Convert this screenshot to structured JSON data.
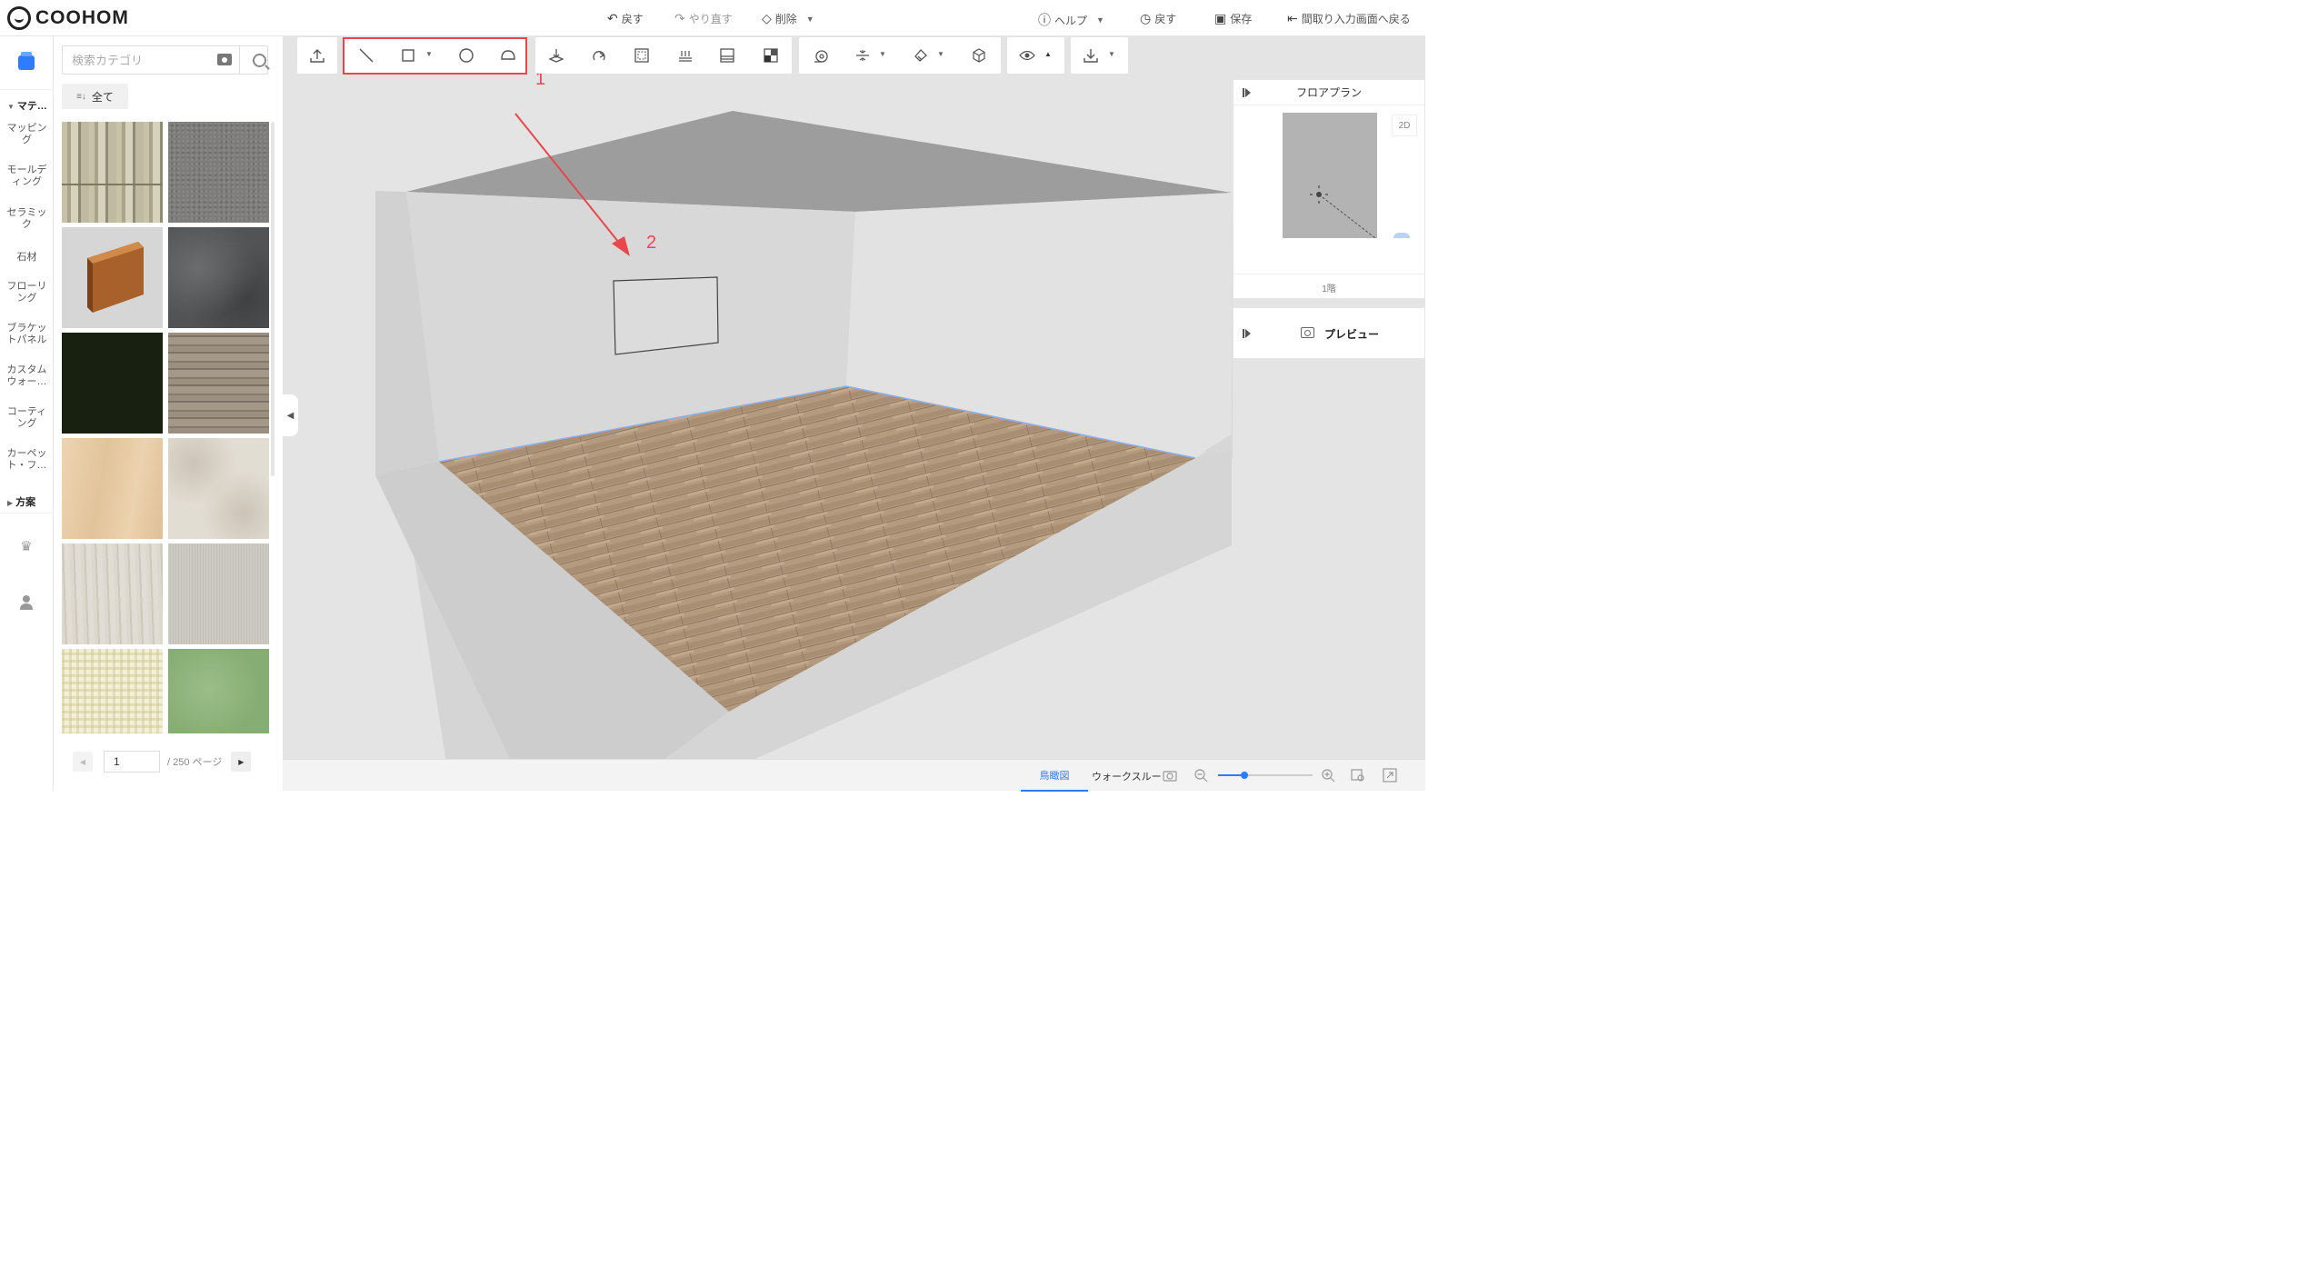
{
  "app": {
    "logo": "COOHOM"
  },
  "topbar": {
    "undo": "戻す",
    "redo": "やり直す",
    "delete": "削除",
    "help": "ヘルプ",
    "history": "戻す",
    "save": "保存",
    "back_to_floorplan": "間取り入力画面へ戻る"
  },
  "sidebar": {
    "groups": [
      {
        "label": "マテ…",
        "expanded": true
      },
      {
        "label": "方案",
        "expanded": false
      }
    ],
    "items": [
      {
        "label": "マッピング"
      },
      {
        "label": "モールディング"
      },
      {
        "label": "セラミック"
      },
      {
        "label": "石材"
      },
      {
        "label": "フローリング"
      },
      {
        "label": "ブラケットパネル"
      },
      {
        "label": "カスタムウォー…"
      },
      {
        "label": "コーティング"
      },
      {
        "label": "カーペット・フ…"
      }
    ]
  },
  "catalog": {
    "search_placeholder": "検索カテゴリ",
    "filter_all": "全て",
    "tiles": [
      {
        "name": "weathered-wood",
        "color": "#b2ad94"
      },
      {
        "name": "grey-fabric",
        "color": "#7f7d7b"
      },
      {
        "name": "wood-baseboard",
        "color": "#d4d4d4"
      },
      {
        "name": "dark-stone",
        "color": "#555759"
      },
      {
        "name": "dark-green",
        "color": "#172011"
      },
      {
        "name": "oak-planks",
        "color": "#8f8374"
      },
      {
        "name": "light-maple",
        "color": "#e7cca6"
      },
      {
        "name": "cream-marble",
        "color": "#d8d2c6"
      },
      {
        "name": "pale-wood",
        "color": "#d4cfc4"
      },
      {
        "name": "light-grey-linen",
        "color": "#c9c6c0"
      },
      {
        "name": "yellow-gingham",
        "color": "#e7e2c4"
      },
      {
        "name": "green-felt",
        "color": "#8ab178"
      }
    ],
    "page": {
      "current": "1",
      "total_label": "/ 250 ページ"
    }
  },
  "viewport": {
    "annotations": {
      "box_label": "1",
      "arrow_label": "2"
    },
    "floorplan": {
      "title": "フロアプラン",
      "view2d": "2D",
      "floor": "1階"
    },
    "preview": {
      "label": "プレビュー"
    },
    "bottom_tabs": [
      {
        "label": "鳥瞰図",
        "active": true
      },
      {
        "label": "ウォークスルー",
        "active": false
      }
    ]
  },
  "colors": {
    "accent": "#2f7dff",
    "annotation": "#e8474b",
    "wall": "#dcdcdc",
    "floor": "#b89e82"
  }
}
